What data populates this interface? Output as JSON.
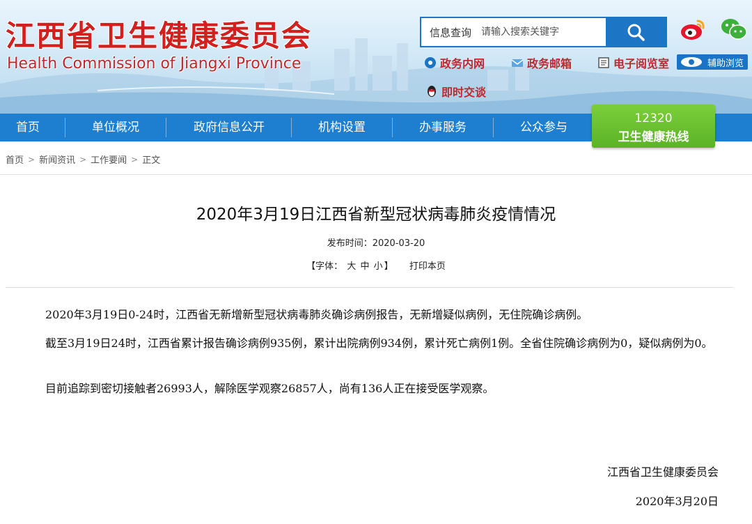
{
  "header": {
    "title_cn": "江西省卫生健康委员会",
    "title_en": "Health Commission of Jiangxi Province",
    "search_label": "信息查询",
    "search_placeholder": "请输入搜索关键字"
  },
  "quick_links": {
    "intranet": "政务内网",
    "mail": "政务邮箱",
    "reading_room": "电子阅览室",
    "assist": "辅助浏览",
    "chat": "即时交谈"
  },
  "nav": {
    "items": [
      "首页",
      "单位概况",
      "政府信息公开",
      "机构设置",
      "办事服务",
      "公众参与"
    ],
    "hotline_number": "12320",
    "hotline_label": "卫生健康热线"
  },
  "breadcrumb": [
    "首页",
    "新闻资讯",
    "工作要闻",
    "正文"
  ],
  "article": {
    "title": "2020年3月19日江西省新型冠状病毒肺炎疫情情况",
    "pub_label": "发布时间：",
    "pub_date": "2020-03-20",
    "font_label": "【字体：",
    "font_large": "大",
    "font_medium": "中",
    "font_small": "小",
    "font_close": "】",
    "print": "打印本页",
    "paragraphs": [
      "2020年3月19日0-24时，江西省无新增新型冠状病毒肺炎确诊病例报告，无新增疑似病例，无住院确诊病例。",
      "截至3月19日24时，江西省累计报告确诊病例935例，累计出院病例934例，累计死亡病例1例。全省住院确诊病例为0，疑似病例为0。",
      "目前追踪到密切接触者26993人，解除医学观察26857人，尚有136人正在接受医学观察。"
    ],
    "signature": "江西省卫生健康委员会",
    "sign_date": "2020年3月20日"
  },
  "colors": {
    "brand_red": "#d2201f",
    "nav_blue": "#1e7ed0",
    "hotline_green": "#5bb327"
  }
}
